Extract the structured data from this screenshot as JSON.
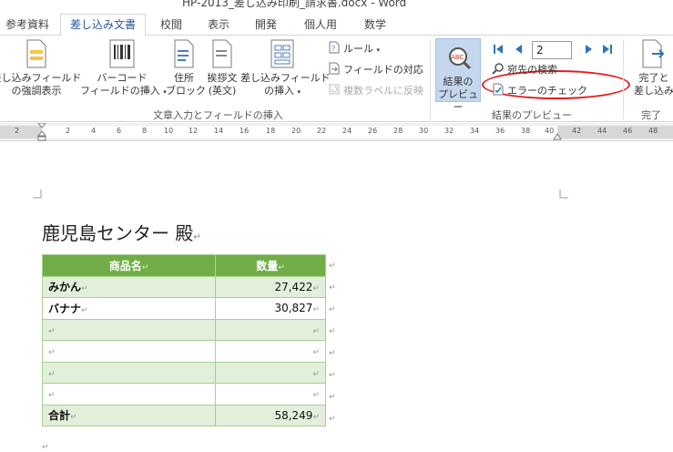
{
  "window": {
    "title": "HP-2013_差し込み印刷_請求書.docx - Word"
  },
  "tabs": [
    {
      "label": "参考資料",
      "active": false
    },
    {
      "label": "差し込み文書",
      "active": true
    },
    {
      "label": "校閲",
      "active": false
    },
    {
      "label": "表示",
      "active": false
    },
    {
      "label": "開発",
      "active": false
    },
    {
      "label": "個人用",
      "active": false
    },
    {
      "label": "数学",
      "active": false
    }
  ],
  "ribbon": {
    "insert_group": {
      "label": "文章入力とフィールドの挿入",
      "highlight_fields": {
        "line1": "差し込みフィールド",
        "line2": "の強調表示"
      },
      "barcode_field": {
        "line1": "バーコード",
        "line2": "フィールドの挿入"
      },
      "address_block": {
        "line1": "住所",
        "line2": "ブロック"
      },
      "greeting_line": {
        "line1": "挨拶文",
        "line2": "(英文)"
      },
      "insert_merge_field": {
        "line1": "差し込みフィールド",
        "line2": "の挿入"
      },
      "rules": "ルール",
      "match_fields": "フィールドの対応",
      "update_labels": "複数ラベルに反映"
    },
    "preview_group": {
      "label": "結果のプレビュー",
      "preview_results": {
        "line1": "結果の",
        "line2": "プレビュー"
      },
      "record_number": "2",
      "find_recipient": "宛先の検索",
      "check_errors": "エラーのチェック"
    },
    "finish_group": {
      "label": "完了",
      "finish_merge": {
        "line1": "完了と",
        "line2": "差し込み"
      }
    }
  },
  "ruler": {
    "marks": [
      "2",
      "2",
      "4",
      "6",
      "8",
      "10",
      "12",
      "14",
      "16",
      "18",
      "20",
      "22",
      "24",
      "26",
      "28",
      "30",
      "32",
      "34",
      "36",
      "38",
      "40",
      "42",
      "44",
      "46",
      "48"
    ]
  },
  "document": {
    "heading": "鹿児島センター 殿",
    "table": {
      "headers": [
        "商品名",
        "数量"
      ],
      "rows": [
        {
          "name": "みかん",
          "qty": "27,422"
        },
        {
          "name": "バナナ",
          "qty": "30,827"
        },
        {
          "name": "",
          "qty": ""
        },
        {
          "name": "",
          "qty": ""
        },
        {
          "name": "",
          "qty": ""
        },
        {
          "name": "",
          "qty": ""
        },
        {
          "name": "合計",
          "qty": "58,249"
        }
      ]
    }
  },
  "colors": {
    "table_header": "#70ad47",
    "table_band": "#e2efda",
    "accent": "#2b579a",
    "highlight_oval": "#e02020"
  }
}
